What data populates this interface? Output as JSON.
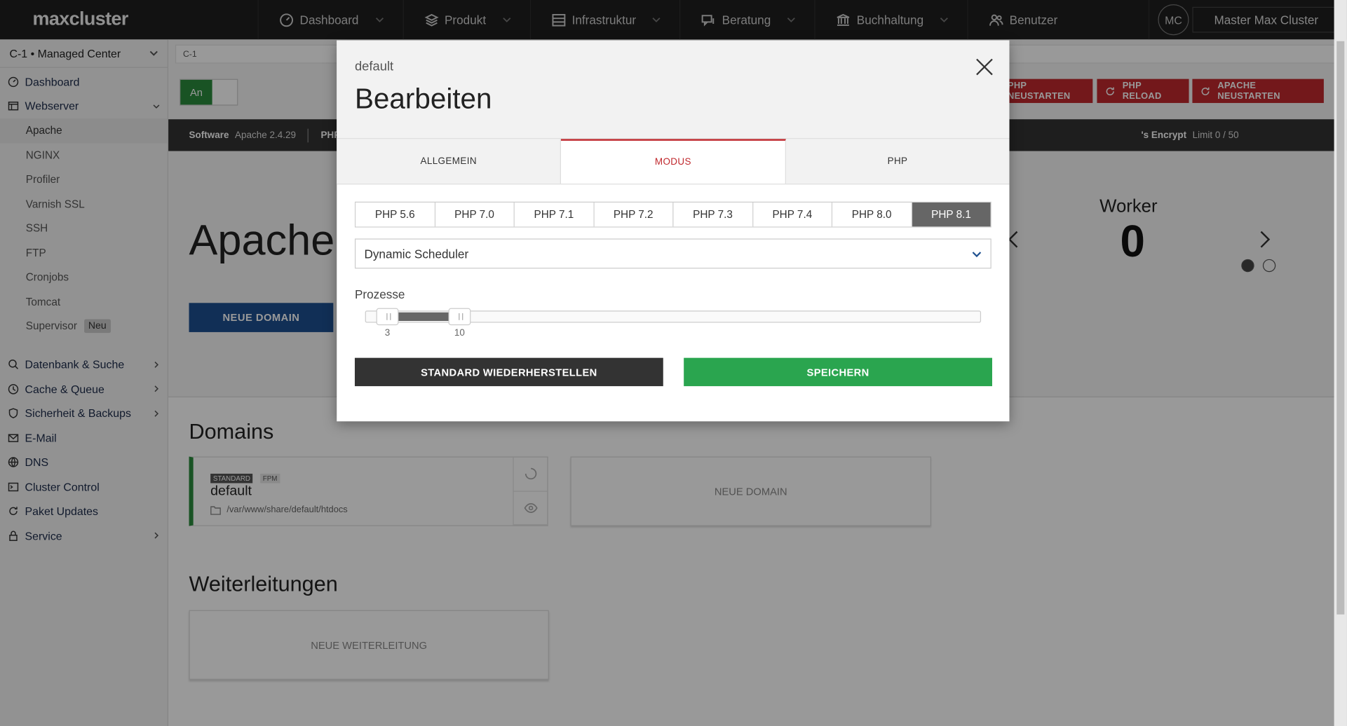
{
  "app": {
    "logo": "maxcluster"
  },
  "topnav": {
    "items": [
      {
        "label": "Dashboard",
        "icon": "gauge-icon"
      },
      {
        "label": "Produkt",
        "icon": "layers-icon"
      },
      {
        "label": "Infrastruktur",
        "icon": "server-icon"
      },
      {
        "label": "Beratung",
        "icon": "chat-icon"
      },
      {
        "label": "Buchhaltung",
        "icon": "bank-icon"
      },
      {
        "label": "Benutzer",
        "icon": "users-icon"
      }
    ],
    "avatar_initials": "MC",
    "user_name": "Master Max Cluster"
  },
  "sidebar": {
    "center_select": "C-1 • Managed Center",
    "items": [
      {
        "label": "Dashboard",
        "icon": "gauge-icon"
      },
      {
        "label": "Webserver",
        "icon": "window-icon"
      },
      {
        "label": "Datenbank & Suche",
        "icon": "database-icon"
      },
      {
        "label": "Cache & Queue",
        "icon": "clock-icon"
      },
      {
        "label": "Sicherheit & Backups",
        "icon": "shield-icon"
      },
      {
        "label": "E-Mail",
        "icon": "mail-icon"
      },
      {
        "label": "DNS",
        "icon": "globe-icon"
      },
      {
        "label": "Cluster Control",
        "icon": "terminal-icon"
      },
      {
        "label": "Paket Updates",
        "icon": "refresh-icon"
      },
      {
        "label": "Service",
        "icon": "lock-icon"
      }
    ],
    "webserver_sub": [
      "Apache",
      "NGINX",
      "Profiler",
      "Varnish SSL",
      "SSH",
      "FTP",
      "Cronjobs",
      "Tomcat",
      "Supervisor"
    ],
    "supervisor_badge": "Neu"
  },
  "main": {
    "breadcrumb": "C-1",
    "toggle_label": "An",
    "buttons": {
      "php_restart": "PHP NEUSTARTEN",
      "php_reload": "PHP RELOAD",
      "apache_restart": "APACHE NEUSTARTEN"
    },
    "infobar": {
      "software_label": "Software",
      "software_value": "Apache 2.4.29",
      "php_label": "PHP",
      "letsencrypt_label": "'s Encrypt",
      "limit": "Limit 0 / 50"
    },
    "title": "Apache",
    "new_domain_button": "NEUE DOMAIN",
    "worker": {
      "title": "Worker",
      "value": "0"
    },
    "domains_title": "Domains",
    "domain_card": {
      "tag_standard": "STANDARD",
      "tag_fpm": "FPM",
      "name": "default",
      "path": "/var/www/share/default/htdocs"
    },
    "new_domain_card": "NEUE DOMAIN",
    "redirects_title": "Weiterleitungen",
    "new_redirect_card": "NEUE WEITERLEITUNG"
  },
  "modal": {
    "subtitle": "default",
    "title": "Bearbeiten",
    "tabs": [
      "ALLGEMEIN",
      "MODUS",
      "PHP"
    ],
    "active_tab": "MODUS",
    "php_versions": [
      "PHP 5.6",
      "PHP 7.0",
      "PHP 7.1",
      "PHP 7.2",
      "PHP 7.3",
      "PHP 7.4",
      "PHP 8.0",
      "PHP 8.1"
    ],
    "selected_php": "PHP 8.1",
    "scheduler": "Dynamic Scheduler",
    "processes_label": "Prozesse",
    "slider": {
      "min_label": "3",
      "max_label": "10",
      "low": 3,
      "high": 10
    },
    "reset_button": "STANDARD WIEDERHERSTELLEN",
    "save_button": "SPEICHERN"
  },
  "colors": {
    "accent_red": "#c0282d",
    "save_green": "#2aa54f",
    "primary_blue": "#1d4f8f",
    "toggle_green": "#2a8a3c"
  }
}
